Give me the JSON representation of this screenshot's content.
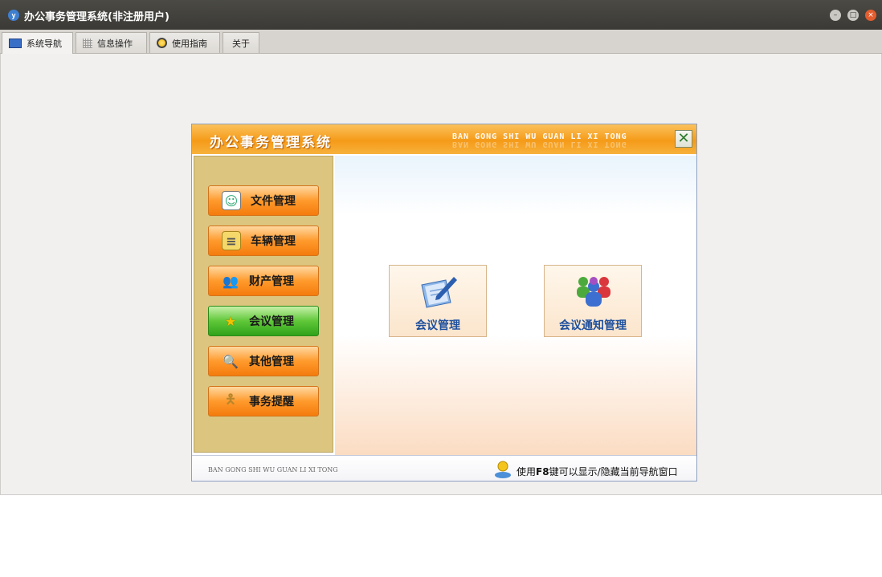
{
  "window": {
    "title": "办公事务管理系统(非注册用户)",
    "icon": "app-logo-icon"
  },
  "tabs": [
    {
      "label": "系统导航",
      "icon": "monitor-icon",
      "active": true
    },
    {
      "label": "信息操作",
      "icon": "grid-icon",
      "active": false
    },
    {
      "label": "使用指南",
      "icon": "guide-icon",
      "active": false
    },
    {
      "label": "关于",
      "icon": "",
      "active": false
    }
  ],
  "dialog": {
    "title": "办公事务管理系统",
    "pinyin": "BAN GONG SHI WU GUAN LI XI TONG",
    "close_glyph": "✕"
  },
  "sidebar": {
    "items": [
      {
        "label": "文件管理",
        "icon": "id-card-icon",
        "active": false
      },
      {
        "label": "车辆管理",
        "icon": "document-icon",
        "active": false
      },
      {
        "label": "财产管理",
        "icon": "people-icon",
        "active": false
      },
      {
        "label": "会议管理",
        "icon": "star-icon",
        "active": true
      },
      {
        "label": "其他管理",
        "icon": "magnifier-icon",
        "active": false
      },
      {
        "label": "事务提醒",
        "icon": "person-icon",
        "active": false
      }
    ]
  },
  "features": [
    {
      "label": "会议管理",
      "icon": "pen-paper-icon"
    },
    {
      "label": "会议通知管理",
      "icon": "group-users-icon"
    }
  ],
  "footer": {
    "left_text": "BAN GONG SHI WU GUAN LI XI TONG",
    "hint_prefix": "使用",
    "hint_key": "F8",
    "hint_suffix": "键可以显示/隐藏当前导航窗口"
  },
  "colors": {
    "header_orange": "#f59a18",
    "sidebar_gold": "#dcc67f",
    "active_green": "#5fc738",
    "feature_label_blue": "#1d4f9e"
  }
}
